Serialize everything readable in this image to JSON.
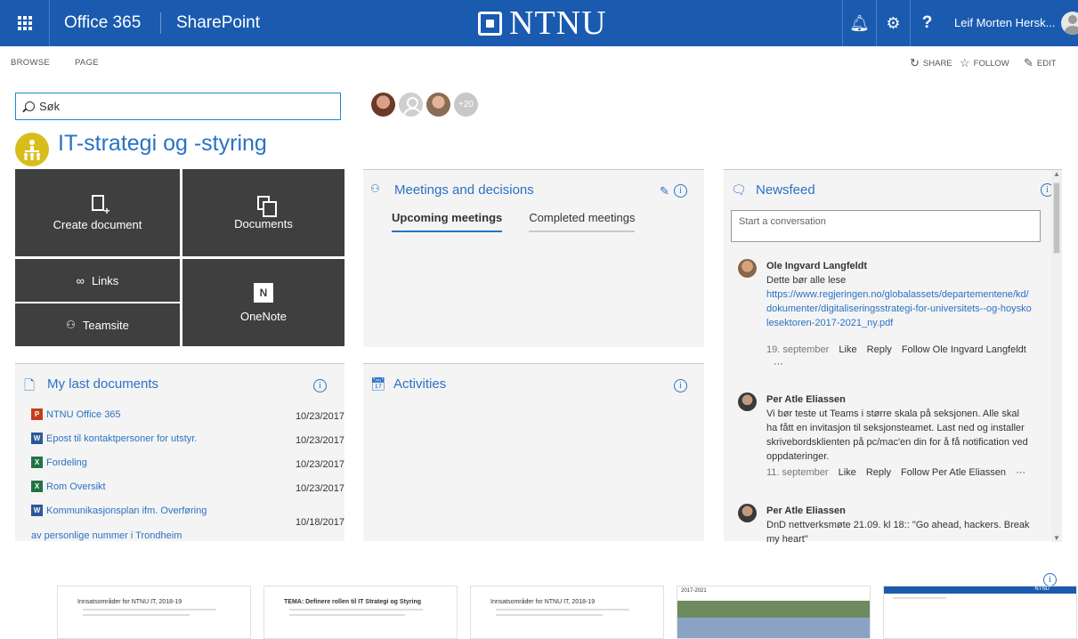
{
  "suitebar": {
    "app1": "Office 365",
    "app2": "SharePoint",
    "logo_text": "NTNU",
    "user": "Leif Morten Hersk..."
  },
  "ribbon": {
    "browse": "BROWSE",
    "page": "PAGE",
    "share": "SHARE",
    "follow": "FOLLOW",
    "edit": "EDIT"
  },
  "search": {
    "placeholder": "Søk"
  },
  "members": {
    "extra": "+20"
  },
  "site": {
    "title": "IT-strategi og -styring"
  },
  "tiles": {
    "create_document": "Create document",
    "documents": "Documents",
    "links": "Links",
    "onenote": "OneNote",
    "teamsite": "Teamsite"
  },
  "meetings": {
    "title": "Meetings and decisions",
    "tab_upcoming": "Upcoming meetings",
    "tab_completed": "Completed meetings"
  },
  "activities": {
    "title": "Activities"
  },
  "mydocs": {
    "title": "My last documents",
    "items": [
      {
        "type": "P",
        "name": "NTNU Office 365",
        "date": "10/23/2017"
      },
      {
        "type": "W",
        "name": "Epost til kontaktpersoner for utstyr.",
        "date": "10/23/2017"
      },
      {
        "type": "X",
        "name": "Fordeling",
        "date": "10/23/2017"
      },
      {
        "type": "X",
        "name": "Rom Oversikt",
        "date": "10/23/2017"
      },
      {
        "type": "W",
        "name": "Kommunikasjonsplan ifm. Overføring",
        "name2": "av personlige nummer i Trondheim",
        "date": "10/18/2017"
      }
    ]
  },
  "newsfeed": {
    "title": "Newsfeed",
    "placeholder": "Start a conversation",
    "posts": [
      {
        "author": "Ole Ingvard Langfeldt",
        "text": "Dette bør alle lese",
        "link": "https://www.regjeringen.no/globalassets/departementene/kd/dokumenter/digitaliseringsstrategi-for-universitets--og-hoyskolesektoren-2017-2021_ny.pdf",
        "date": "19. september",
        "like": "Like",
        "reply": "Reply",
        "follow": "Follow Ole Ingvard Langfeldt",
        "more": "···"
      },
      {
        "author": "Per Atle Eliassen",
        "text": "Vi bør teste ut Teams i større skala på seksjonen. Alle skal ha fått en invitasjon til seksjonsteamet. Last ned og installer skrivebordsklienten på pc/mac'en din for å få notification ved oppdateringer.",
        "date": "11. september",
        "like": "Like",
        "reply": "Reply",
        "follow": "Follow Per Atle Eliassen",
        "more": "···"
      },
      {
        "author": "Per Atle Eliassen",
        "text": "DnD nettverksmøte 21.09. kl 18:: \"Go ahead, hackers. Break my heart\""
      }
    ]
  },
  "thumbnails": [
    {
      "title": "Innsatsområder for NTNU IT, 2018-19"
    },
    {
      "title": "TEMA: Definere rollen til IT Strategi og Styring"
    },
    {
      "title": "Innsatsområder for NTNU IT, 2018-19"
    },
    {
      "title": "2017-2021"
    },
    {
      "title": "NTNU"
    }
  ],
  "colors": {
    "suitebar": "#1a5bb0",
    "accent": "#2a72c4",
    "tile": "#3f3f3f",
    "site_logo": "#d9bd1c"
  }
}
